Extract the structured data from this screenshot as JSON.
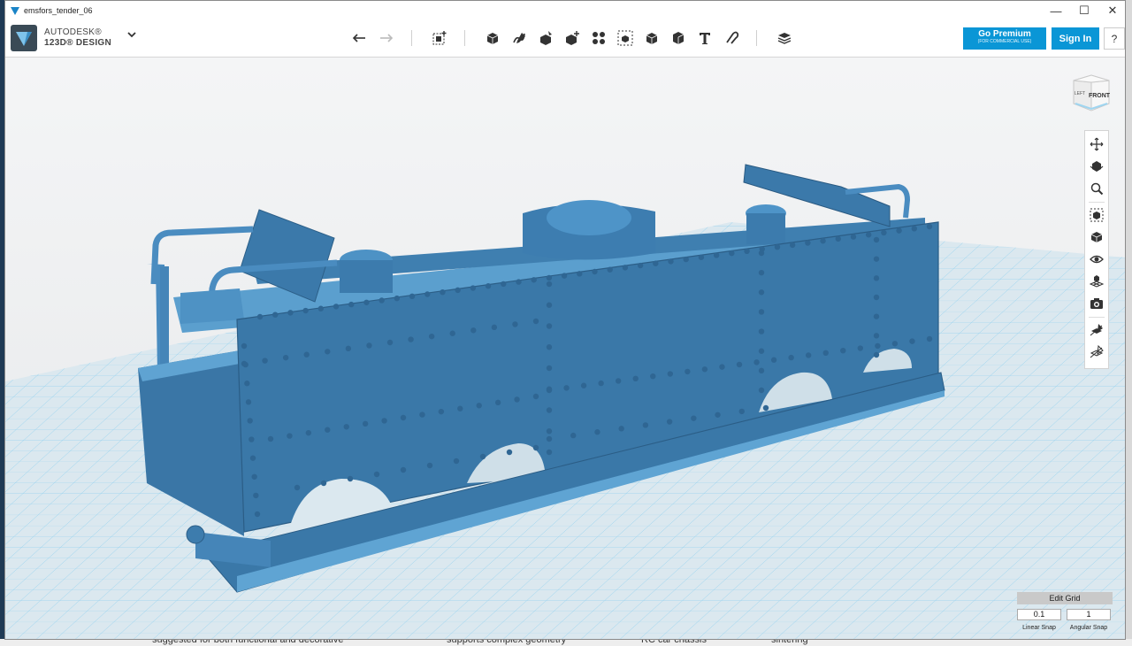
{
  "window": {
    "title": "emsfors_tender_06"
  },
  "window_controls": {
    "minimize": "—",
    "maximize": "☐",
    "close": "✕"
  },
  "brand": {
    "line1": "AUTODESK®",
    "line2": "123D® DESIGN",
    "menu_icon": "chevron-down-icon"
  },
  "toolbar": {
    "undo": "undo-icon",
    "redo": "redo-icon",
    "tools": [
      "transform-icon",
      "primitives-icon",
      "sketch-icon",
      "construct-icon",
      "modify-icon",
      "pattern-icon",
      "grouping-icon",
      "combine-icon",
      "measure-icon",
      "text-icon",
      "snap-icon",
      "materials-icon"
    ]
  },
  "account": {
    "premium_label": "Go Premium",
    "premium_sub": "(FOR COMMERCIAL USE)",
    "signin_label": "Sign In",
    "help_label": "?"
  },
  "viewcube": {
    "front": "FRONT",
    "left": "LEFT"
  },
  "nav_tools": [
    "pan-icon",
    "orbit-icon",
    "zoom-icon",
    "fit-icon",
    "view-mode-icon",
    "visibility-icon",
    "grid-settings-icon",
    "camera-icon",
    "solid-render-icon",
    "wireframe-render-icon"
  ],
  "grid_panel": {
    "title": "Edit Grid",
    "linear_value": "0.1",
    "angular_value": "1",
    "linear_label": "Linear Snap",
    "angular_label": "Angular Snap"
  },
  "background_text": [
    "suggested for both functional and decorative",
    "supports complex geometry",
    "RC car chassis",
    "sintering"
  ],
  "colors": {
    "accent": "#0a96d6",
    "model": "#3d7fb0",
    "grid_bg": "#e8edf1"
  }
}
